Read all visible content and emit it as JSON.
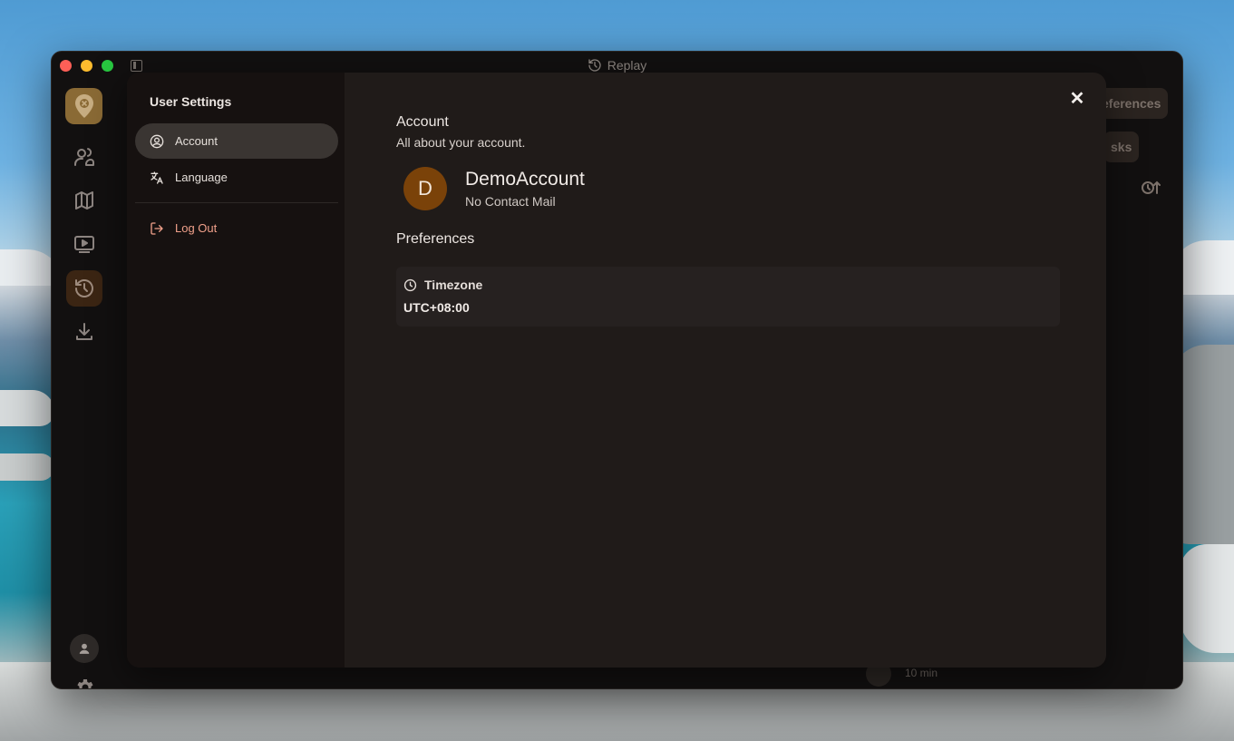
{
  "window": {
    "title": "Replay"
  },
  "background": {
    "pill_preferences": "eferences",
    "pill_tasks": "sks",
    "duration": "10 min"
  },
  "nav": {
    "items": [
      "users-icon",
      "map-icon",
      "play-icon",
      "history-icon",
      "download-icon"
    ],
    "active": "history-icon"
  },
  "modal": {
    "sidebar": {
      "title": "User Settings",
      "items": [
        {
          "label": "Account",
          "icon": "user-circle-icon"
        },
        {
          "label": "Language",
          "icon": "translate-icon"
        }
      ],
      "logout_label": "Log Out"
    },
    "account": {
      "title": "Account",
      "subtitle": "All about your account.",
      "avatar_letter": "D",
      "name": "DemoAccount",
      "mail": "No Contact Mail"
    },
    "preferences": {
      "title": "Preferences",
      "timezone_label": "Timezone",
      "timezone_value": "UTC+08:00"
    }
  },
  "colors": {
    "accent": "#7a4209",
    "logout": "#f0a08a",
    "active_nav": "#3b2513"
  }
}
